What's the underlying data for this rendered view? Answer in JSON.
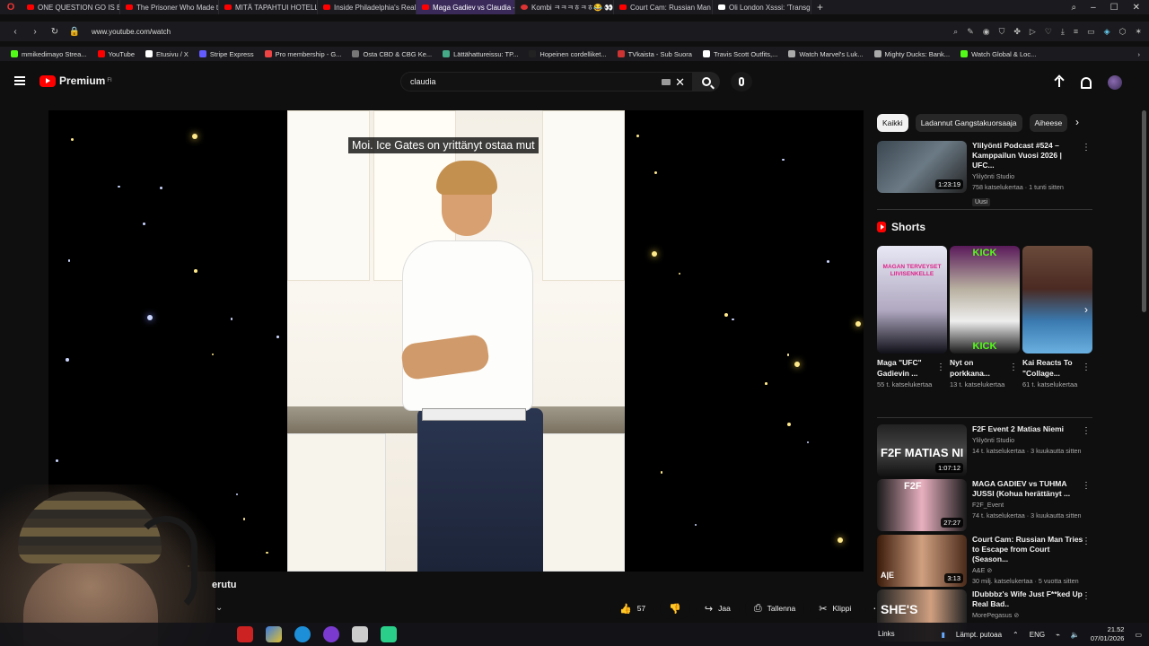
{
  "browser": {
    "tabs": [
      {
        "label": "ONE QUESTION GO IS BA",
        "icon": "youtube"
      },
      {
        "label": "The Prisoner Who Made t",
        "icon": "youtube"
      },
      {
        "label": "MITÄ TAPAHTUI HOTELLI",
        "icon": "youtube"
      },
      {
        "label": "Inside Philadelphia's Real",
        "icon": "youtube"
      },
      {
        "label": "Maga Gadiev vs Claudia -",
        "icon": "youtube",
        "active": true
      },
      {
        "label": "Kombi ㅋㅋㅋㅎㅋㅎ😂 👀",
        "icon": "clip"
      },
      {
        "label": "Court Cam: Russian Man",
        "icon": "youtube"
      },
      {
        "label": "Oli London Xsssi: 'Transg",
        "icon": "x"
      }
    ],
    "url": "www.youtube.com/watch",
    "bookmarks": [
      "mmikedimayo Strea...",
      "YouTube",
      "Etusivu / X",
      "Stripe Express",
      "Pro membership - G...",
      "Osta CBD & CBG Ke...",
      "Lättähattureissu: TP...",
      "Hopeinen cordelliket...",
      "TVkaista - Sub Suora",
      "Travis Scott Outfits,...",
      "Watch Marvel's Luk...",
      "Mighty Ducks: Bank...",
      "Watch Global & Loc..."
    ]
  },
  "header": {
    "logo": "Premium",
    "logo_sup": "FI",
    "search_value": "claudia"
  },
  "video": {
    "caption": "Moi. Ice Gates on yrittänyt ostaa mut",
    "title_fragment": "erutu",
    "likes": "57",
    "share_label": "Jaa",
    "save_label": "Tallenna",
    "clip_label": "Klippi"
  },
  "chips": [
    "Kaikki",
    "Ladannut Gangstakuorsaaja",
    "Aiheese"
  ],
  "top_rec": {
    "title": "Ylilyönti Podcast #524 – Kamppailun Vuosi 2026 | UFC...",
    "channel": "Ylilyönti Studio",
    "meta": "758 katselukertaa · 1 tunti sitten",
    "badge": "Uusi",
    "duration": "1:23:19"
  },
  "shorts": {
    "heading": "Shorts",
    "items": [
      {
        "title": "Maga \"UFC\" Gadievin ...",
        "views": "55 t. katselukertaa",
        "overlay": "MAGAN TERVEYSET LIIVISENKELLE"
      },
      {
        "title": "Nyt on porkkana...",
        "views": "13 t. katselukertaa",
        "overlay": "KICK"
      },
      {
        "title": "Kai Reacts To \"Collage...",
        "views": "61 t. katselukertaa",
        "overlay": ""
      }
    ]
  },
  "recs": [
    {
      "title": "F2F Event 2 Matias Niemi",
      "channel": "Ylilyönti Studio",
      "meta": "14 t. katselukertaa · 3 kuukautta sitten",
      "duration": "1:07:12",
      "overlay": "F2F MATIAS NI"
    },
    {
      "title": "MAGA GADIEV vs TUHMA JUSSI (Kohua herättänyt ...",
      "channel": "F2F_Event",
      "meta": "74 t. katselukertaa · 3 kuukautta sitten",
      "duration": "27:27",
      "overlay": "F2F"
    },
    {
      "title": "Court Cam: Russian Man Tries to Escape from Court (Season...",
      "channel": "A&E ⊘",
      "meta": "30 milj. katselukertaa · 5 vuotta sitten",
      "duration": "3:13",
      "overlay": "A|E"
    },
    {
      "title": "lDubbbz's Wife Just F**ked Up Real Bad..",
      "channel": "MorePegasus ⊘",
      "meta": "",
      "duration": "",
      "overlay": "SHE'S"
    }
  ],
  "taskbar": {
    "links": "Links",
    "weather": "Lämpt. putoaa",
    "lang": "ENG",
    "time": "21.52",
    "date": "07/01/2026"
  }
}
